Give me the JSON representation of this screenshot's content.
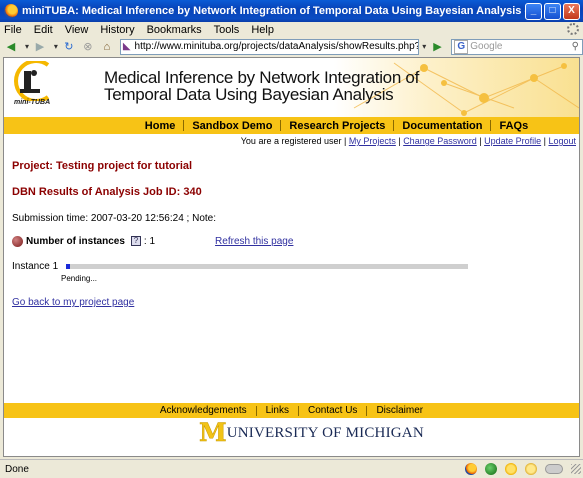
{
  "window": {
    "title": "miniTUBA: Medical Inference by Network Integration of Temporal Data Using Bayesian Analysis - Mozilla Firefox",
    "min_label": "_",
    "max_label": "□",
    "close_label": "X"
  },
  "menubar": {
    "items": [
      "File",
      "Edit",
      "View",
      "History",
      "Bookmarks",
      "Tools",
      "Help"
    ]
  },
  "navbar": {
    "url": "http://www.minituba.org/projects/dataAnalysis/showResults.php?c_job_key=",
    "search_placeholder": "Google",
    "search_engine_letter": "G"
  },
  "banner": {
    "logo_text": "mini-TUBA",
    "title_line1": "Medical Inference by Network Integration of",
    "title_line2": "Temporal Data Using Bayesian Analysis"
  },
  "topnav": {
    "items": [
      "Home",
      "Sandbox Demo",
      "Research Projects",
      "Documentation",
      "FAQs"
    ]
  },
  "userbar": {
    "status_text": "You are a registered user",
    "links": [
      "My Projects",
      "Change Password",
      "Update Profile",
      "Logout"
    ]
  },
  "content": {
    "project_title": "Project: Testing project for tutorial",
    "job_title": "DBN Results of Analysis Job ID: 340",
    "submission": "Submission time: 2007-03-20 12:56:24 ; Note:",
    "instances_label": "Number of instances",
    "help_glyph": "?",
    "instances_value": ": 1",
    "refresh_link": "Refresh this page",
    "instance_label": "Instance 1",
    "instance_progress": 0.01,
    "pending_text": "Pending...",
    "back_link": "Go back to my project page"
  },
  "footer": {
    "links": [
      "Acknowledgements",
      "Links",
      "Contact Us",
      "Disclaimer"
    ],
    "um_letter": "M",
    "um_text": "UNIVERSITY OF MICHIGAN"
  },
  "statusbar": {
    "text": "Done"
  }
}
